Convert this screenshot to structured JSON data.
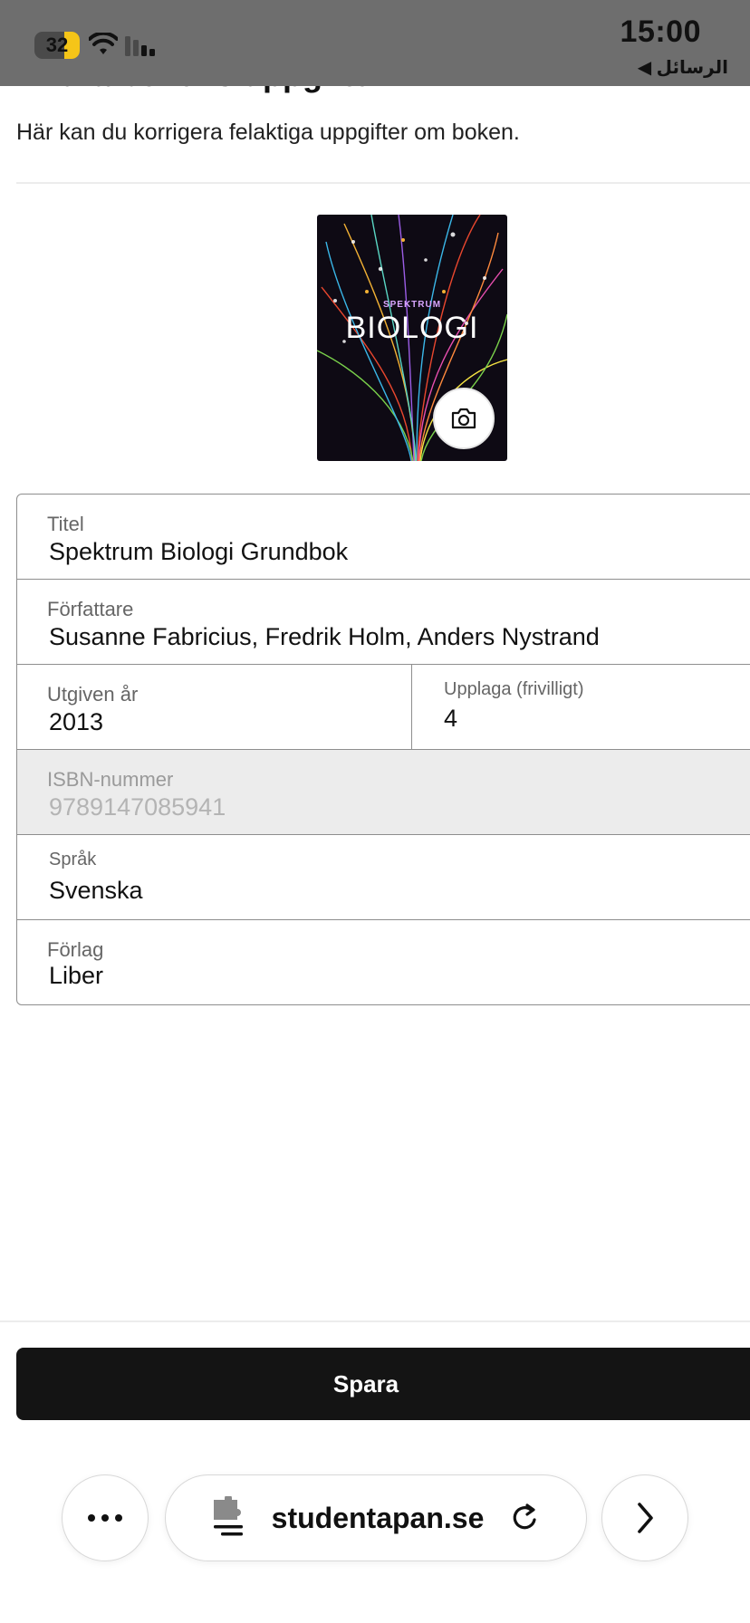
{
  "status_bar": {
    "battery_level": "32",
    "time": "15:00",
    "back_app": "الرسائل ◀"
  },
  "header": {
    "title": "Ändra bokens uppgifter",
    "subtitle": "Här kan du korrigera felaktiga uppgifter om boken."
  },
  "cover": {
    "series": "SPEKTRUM",
    "title": "BIOLOGI",
    "camera_icon": "camera-icon"
  },
  "form": {
    "title": {
      "label": "Titel",
      "value": "Spektrum Biologi Grundbok"
    },
    "authors": {
      "label": "Författare",
      "value": "Susanne Fabricius, Fredrik Holm, Anders Nystrand"
    },
    "year": {
      "label": "Utgiven år",
      "value": "2013"
    },
    "edition": {
      "label": "Upplaga (frivilligt)",
      "value": "4"
    },
    "isbn": {
      "label": "ISBN-nummer",
      "value": "9789147085941"
    },
    "language": {
      "label": "Språk",
      "value": "Svenska"
    },
    "publisher": {
      "label": "Förlag",
      "value": "Liber"
    }
  },
  "actions": {
    "save_label": "Spara"
  },
  "browser": {
    "url": "studentapan.se",
    "icons": [
      "more-icon",
      "extension-icon",
      "reload-icon",
      "forward-icon"
    ]
  },
  "colors": {
    "status_bar": "#6e6e6e",
    "battery_fill": "#f5c518",
    "button": "#141414",
    "border": "#8e8e8e",
    "disabled": "#ececec"
  }
}
